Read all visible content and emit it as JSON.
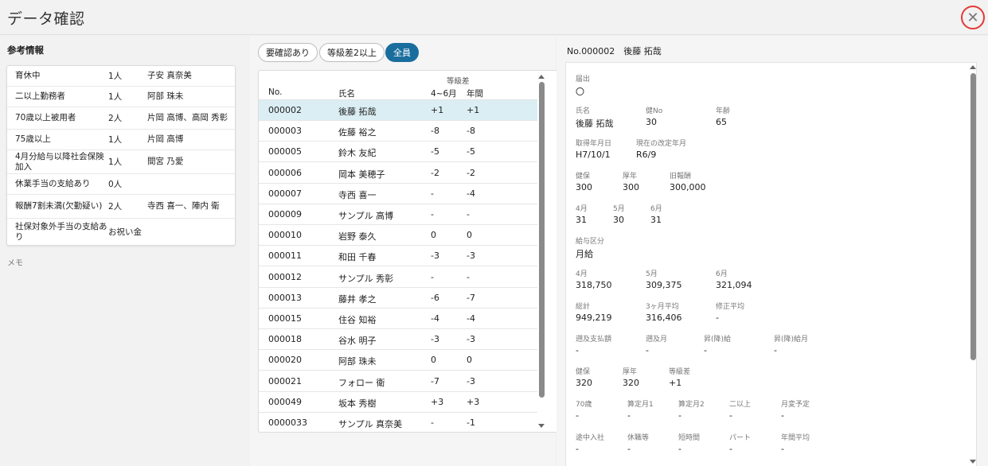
{
  "header": {
    "title": "データ確認",
    "close_icon": "close-icon"
  },
  "reference": {
    "title": "参考情報",
    "rows": [
      {
        "item": "育休中",
        "count": "1人",
        "names": "子安 真奈美"
      },
      {
        "item": "二以上勤務者",
        "count": "1人",
        "names": "阿部 珠未"
      },
      {
        "item": "70歳以上被用者",
        "count": "2人",
        "names": "片岡 高博、高岡 秀彰"
      },
      {
        "item": "75歳以上",
        "count": "1人",
        "names": "片岡 高博"
      },
      {
        "item": "4月分給与以降社会保険加入",
        "count": "1人",
        "names": "間宮 乃愛"
      },
      {
        "item": "休業手当の支給あり",
        "count": "0人",
        "names": ""
      },
      {
        "item": "報酬7割未満(欠勤疑い)",
        "count": "2人",
        "names": "寺西 喜一、陣内 衛"
      },
      {
        "item": "社保対象外手当の支給あり",
        "count": "お祝い金",
        "names": ""
      }
    ],
    "memo_label": "メモ"
  },
  "filters": {
    "needs_check": "要確認あり",
    "grade_diff": "等級差2以上",
    "all": "全員"
  },
  "employee_list": {
    "header": {
      "grade_group": "等級差",
      "no": "No.",
      "name": "氏名",
      "apr_jun": "4~6月",
      "annual": "年間"
    },
    "rows": [
      {
        "no": "000002",
        "name": "後藤 拓哉",
        "apr_jun": "+1",
        "annual": "+1"
      },
      {
        "no": "000003",
        "name": "佐藤 裕之",
        "apr_jun": "-8",
        "annual": "-8"
      },
      {
        "no": "000005",
        "name": "鈴木 友紀",
        "apr_jun": "-5",
        "annual": "-5"
      },
      {
        "no": "000006",
        "name": "岡本 美穂子",
        "apr_jun": "-2",
        "annual": "-2"
      },
      {
        "no": "000007",
        "name": "寺西 喜一",
        "apr_jun": "-",
        "annual": "-4"
      },
      {
        "no": "000009",
        "name": "サンプル 高博",
        "apr_jun": "-",
        "annual": "-"
      },
      {
        "no": "000010",
        "name": "岩野 泰久",
        "apr_jun": "0",
        "annual": "0"
      },
      {
        "no": "000011",
        "name": "和田 千春",
        "apr_jun": "-3",
        "annual": "-3"
      },
      {
        "no": "000012",
        "name": "サンプル 秀彰",
        "apr_jun": "-",
        "annual": "-"
      },
      {
        "no": "000013",
        "name": "藤井 孝之",
        "apr_jun": "-6",
        "annual": "-7"
      },
      {
        "no": "000015",
        "name": "住谷 知裕",
        "apr_jun": "-4",
        "annual": "-4"
      },
      {
        "no": "000018",
        "name": "谷水 明子",
        "apr_jun": "-3",
        "annual": "-3"
      },
      {
        "no": "000020",
        "name": "阿部 珠未",
        "apr_jun": "0",
        "annual": "0"
      },
      {
        "no": "000021",
        "name": "フォロー 衛",
        "apr_jun": "-7",
        "annual": "-3"
      },
      {
        "no": "000049",
        "name": "坂本 秀樹",
        "apr_jun": "+3",
        "annual": "+3"
      },
      {
        "no": "0000033",
        "name": "サンプル 真奈美",
        "apr_jun": "-",
        "annual": "-1"
      }
    ]
  },
  "detail": {
    "heading": "No.000002　後藤 拓哉",
    "notification": {
      "label": "届出",
      "value": "〇"
    },
    "name": {
      "label": "氏名",
      "value": "後藤 拓哉"
    },
    "health_no": {
      "label": "健No",
      "value": "30"
    },
    "age": {
      "label": "年齢",
      "value": "65"
    },
    "acquired": {
      "label": "取得年月日",
      "value": "H7/10/1"
    },
    "current_revision": {
      "label": "現在の改定年月",
      "value": "R6/9"
    },
    "kenpo": {
      "label": "健保",
      "value": "300"
    },
    "kounen": {
      "label": "厚年",
      "value": "300"
    },
    "old_salary": {
      "label": "旧報酬",
      "value": "300,000"
    },
    "days_apr": {
      "label": "4月",
      "value": "31"
    },
    "days_may": {
      "label": "5月",
      "value": "30"
    },
    "days_jun": {
      "label": "6月",
      "value": "31"
    },
    "pay_type": {
      "label": "給与区分",
      "value": "月給"
    },
    "pay_apr": {
      "label": "4月",
      "value": "318,750"
    },
    "pay_may": {
      "label": "5月",
      "value": "309,375"
    },
    "pay_jun": {
      "label": "6月",
      "value": "321,094"
    },
    "total": {
      "label": "総計",
      "value": "949,219"
    },
    "avg3": {
      "label": "3ヶ月平均",
      "value": "316,406"
    },
    "adj_avg": {
      "label": "修正平均",
      "value": "-"
    },
    "retro_amt": {
      "label": "遡及支払額",
      "value": "-"
    },
    "retro_month": {
      "label": "遡及月",
      "value": "-"
    },
    "raise_pay": {
      "label": "昇(降)給",
      "value": "-"
    },
    "raise_month": {
      "label": "昇(降)給月",
      "value": "-"
    },
    "kenpo2": {
      "label": "健保",
      "value": "320"
    },
    "kounen2": {
      "label": "厚年",
      "value": "320"
    },
    "grade_diff": {
      "label": "等級差",
      "value": "+1"
    },
    "age70": {
      "label": "70歳",
      "value": "-"
    },
    "calc_m1": {
      "label": "算定月1",
      "value": "-"
    },
    "calc_m2": {
      "label": "算定月2",
      "value": "-"
    },
    "multi": {
      "label": "二以上",
      "value": "-"
    },
    "change_plan": {
      "label": "月変予定",
      "value": "-"
    },
    "mid_join": {
      "label": "途中入社",
      "value": "-"
    },
    "leave": {
      "label": "休職等",
      "value": "-"
    },
    "short_time": {
      "label": "短時間",
      "value": "-"
    },
    "part": {
      "label": "パート",
      "value": "-"
    },
    "annual_avg": {
      "label": "年間平均",
      "value": "-"
    }
  }
}
